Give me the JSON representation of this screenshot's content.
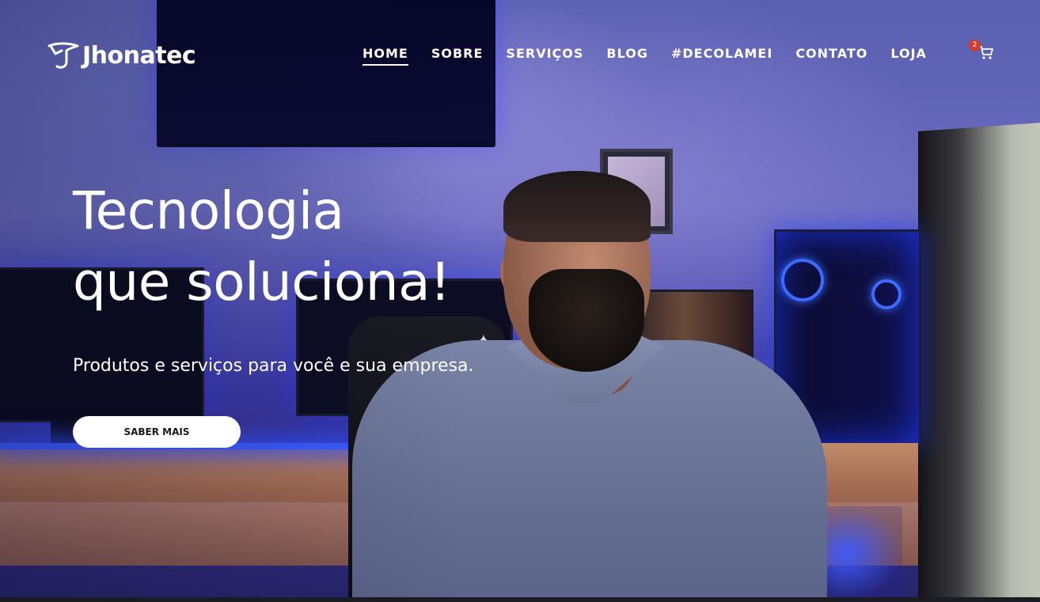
{
  "brand": {
    "name": "Jhonatec",
    "logo_icon": "wing-logo-icon"
  },
  "nav": {
    "items": [
      {
        "label": "HOME",
        "active": true
      },
      {
        "label": "SOBRE"
      },
      {
        "label": "SERVIÇOS"
      },
      {
        "label": "BLOG"
      },
      {
        "label": "#DECOLAMEI"
      },
      {
        "label": "CONTATO"
      },
      {
        "label": "LOJA"
      }
    ]
  },
  "cart": {
    "count": "2",
    "icon": "shopping-cart-icon",
    "badge_color": "#d23a2a"
  },
  "hero": {
    "headline_line1": "Tecnologia",
    "headline_line2": "que soluciona!",
    "subtitle": "Produtos e serviços para você e sua empresa.",
    "cta_label": "SABER MAIS"
  },
  "colors": {
    "text": "#ffffff",
    "cta_bg": "#ffffff",
    "cta_text": "#1a1a1a",
    "led_blue": "#3b5cff"
  }
}
